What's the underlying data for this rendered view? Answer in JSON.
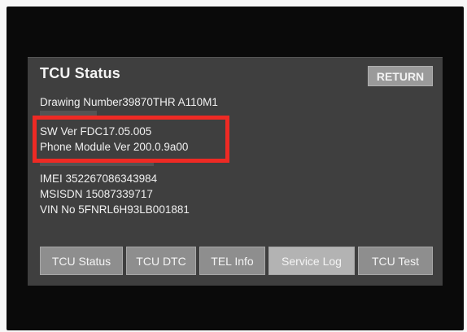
{
  "screen": {
    "title": "TCU Status",
    "return_label": "RETURN"
  },
  "info": {
    "drawing_number": "Drawing Number39870THR A110M1",
    "sw_ver": "SW Ver FDC17.05.005",
    "phone_module_ver": "Phone Module Ver 200.0.9a00",
    "imei": "IMEI  352267086343984",
    "msisdn": "MSISDN 15087339717",
    "vin": "VIN No 5FNRL6H93LB001881"
  },
  "tabs": [
    {
      "label": "TCU Status"
    },
    {
      "label": "TCU DTC"
    },
    {
      "label": "TEL Info"
    },
    {
      "label": "Service Log"
    },
    {
      "label": "TCU Test"
    }
  ],
  "colors": {
    "highlight": "#ee2a24",
    "screen_bg": "#3f3f3f",
    "button_bg": "#8e8e8e"
  }
}
